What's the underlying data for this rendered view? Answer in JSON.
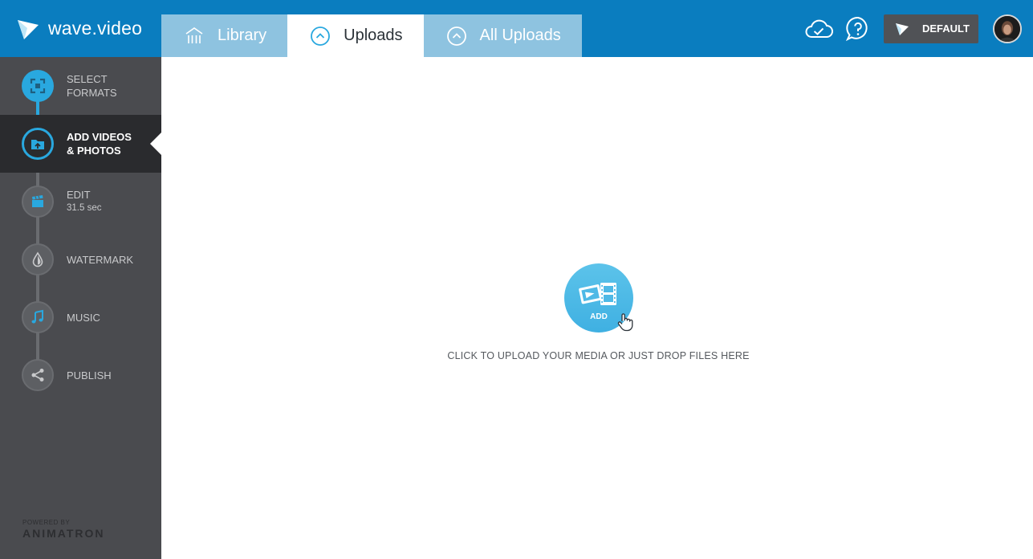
{
  "app": {
    "logo_text": "wave.video",
    "brand_color": "#0a7dbf",
    "accent_color": "#29a8df"
  },
  "tabs": [
    {
      "label": "Library",
      "icon": "library-icon",
      "active": false
    },
    {
      "label": "Uploads",
      "icon": "upload-circle-icon",
      "active": true
    },
    {
      "label": "All Uploads",
      "icon": "upload-circle-icon",
      "active": false
    }
  ],
  "header": {
    "cloud_icon": "cloud-check-icon",
    "help_icon": "help-bubble-icon",
    "default_button_label": "DEFAULT",
    "avatar_icon": "user-avatar"
  },
  "steps": [
    {
      "label_line1": "SELECT",
      "label_line2": "FORMATS",
      "sub": "",
      "icon": "select-formats-icon",
      "state": "done"
    },
    {
      "label_line1": "ADD VIDEOS",
      "label_line2": "& PHOTOS",
      "sub": "",
      "icon": "folder-upload-icon",
      "state": "current"
    },
    {
      "label_line1": "EDIT",
      "label_line2": "",
      "sub": "31.5 sec",
      "icon": "clapperboard-icon",
      "state": "pending"
    },
    {
      "label_line1": "WATERMARK",
      "label_line2": "",
      "sub": "",
      "icon": "drop-icon",
      "state": "pending"
    },
    {
      "label_line1": "MUSIC",
      "label_line2": "",
      "sub": "",
      "icon": "music-note-icon",
      "state": "pending"
    },
    {
      "label_line1": "PUBLISH",
      "label_line2": "",
      "sub": "",
      "icon": "share-icon",
      "state": "pending"
    }
  ],
  "sidebar_footer": {
    "powered_by": "POWERED BY",
    "brand": "ANIMATRON"
  },
  "upload": {
    "add_label": "ADD",
    "hint": "CLICK TO UPLOAD YOUR MEDIA OR JUST DROP FILES HERE"
  }
}
